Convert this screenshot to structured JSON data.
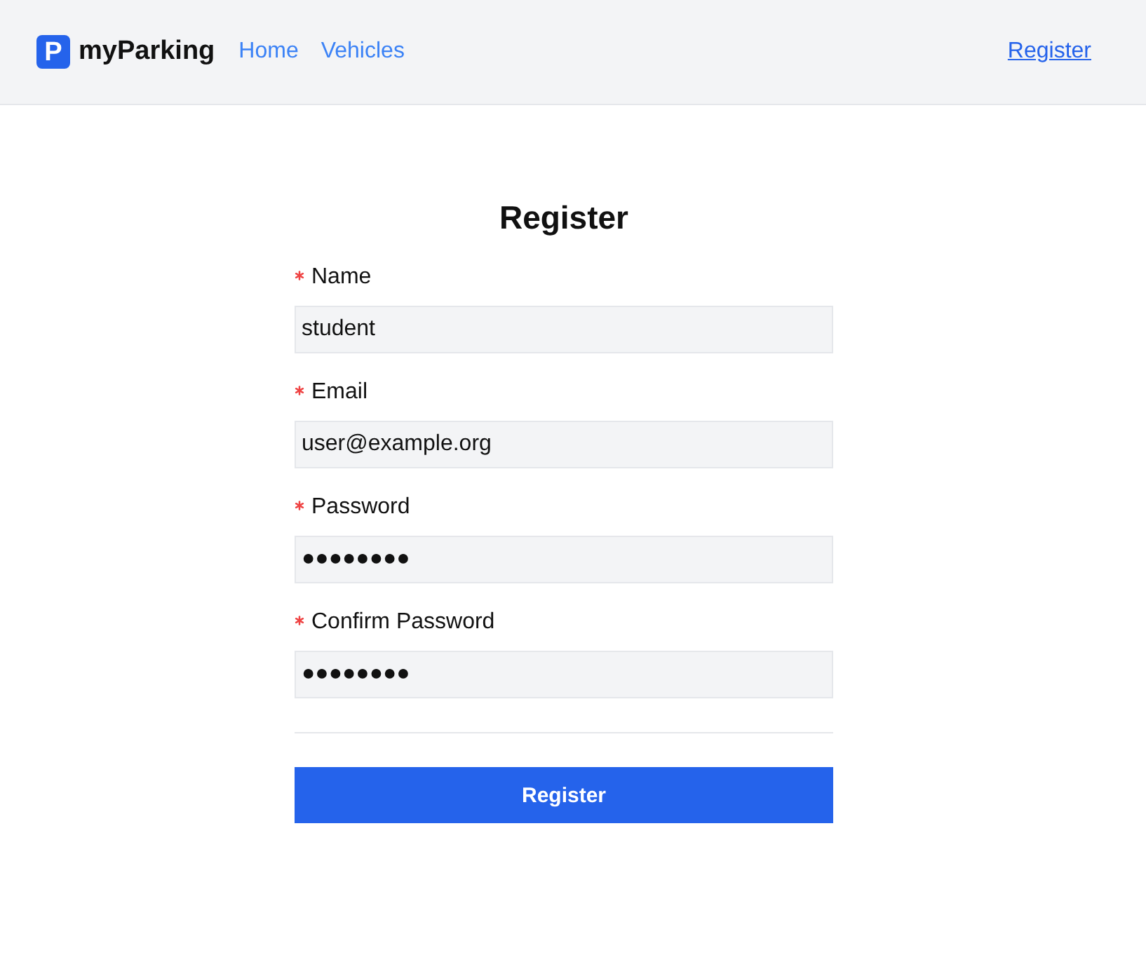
{
  "header": {
    "logo": {
      "letter": "P",
      "name": "myParking"
    },
    "nav": [
      {
        "label": "Home"
      },
      {
        "label": "Vehicles"
      }
    ],
    "account_link": "Register"
  },
  "form": {
    "title": "Register",
    "fields": [
      {
        "label": "Name",
        "required": true,
        "value": "student"
      },
      {
        "label": "Email",
        "required": true,
        "value": "user@example.org"
      },
      {
        "label": "Password",
        "required": true,
        "value": "●●●●●●●●"
      },
      {
        "label": "Confirm Password",
        "required": true,
        "value": "●●●●●●●●"
      }
    ],
    "submit": "Register"
  }
}
